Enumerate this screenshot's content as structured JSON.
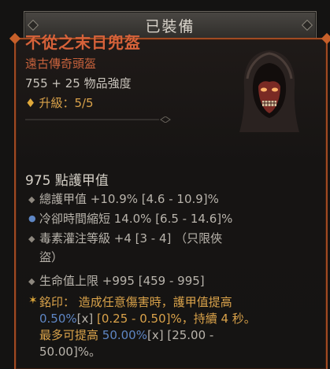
{
  "header": {
    "title": "已裝備"
  },
  "item": {
    "name": "不從之末日兜盔",
    "type": "遠古傳奇頭盔",
    "power": "755 + 25 物品強度",
    "upgrade": "升級：5/5"
  },
  "armor": "975 點護甲值",
  "affixes": [
    {
      "text": "總護甲值 +10.9% [4.6 - 10.9]%"
    },
    {
      "text": "冷卻時間縮短 14.0% [6.5 - 14.6]%"
    },
    {
      "line1": "毒素灌注等級 +4 [3 - 4] （只限俠",
      "line2": "盜）"
    },
    {
      "text": "生命值上限 +995 [459 - 995]"
    }
  ],
  "aspect": {
    "label": "銘印：",
    "l1": "造成任意傷害時，護甲值提高",
    "l2_val": "0.50%",
    "l2_x": "[x]",
    "l2_rest": " [0.25 - 0.50]%，持續 4 秒。",
    "l3_a": "最多可提高 ",
    "l3_val": "50.00%",
    "l3_x": "[x]",
    "l3_rest": " [25.00 -",
    "l4": "50.00]%。"
  },
  "colors": {
    "legendary_orange": "#d6623a",
    "upgrade_gold": "#d9a24a",
    "frame": "#a04a22",
    "affix_blue": "#5e86c4"
  }
}
